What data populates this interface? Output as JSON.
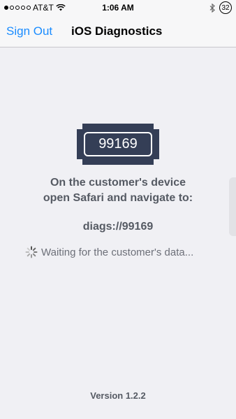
{
  "status_bar": {
    "carrier": "AT&T",
    "time": "1:06 AM",
    "badge": "32",
    "signal_icon": "signal-dots-icon",
    "wifi_icon": "wifi-icon",
    "bluetooth_icon": "bluetooth-icon"
  },
  "nav": {
    "back_label": "Sign Out",
    "title": "iOS Diagnostics"
  },
  "main": {
    "code": "99169",
    "instruction_line1": "On the customer's device",
    "instruction_line2": "open Safari and navigate to:",
    "url": "diags://99169",
    "waiting_text": "Waiting for the customer's data...",
    "spinner_icon": "spinner-icon"
  },
  "footer": {
    "version": "Version 1.2.2"
  },
  "colors": {
    "accent": "#1a8cff",
    "ticket": "#343e56",
    "text": "#555a63"
  }
}
